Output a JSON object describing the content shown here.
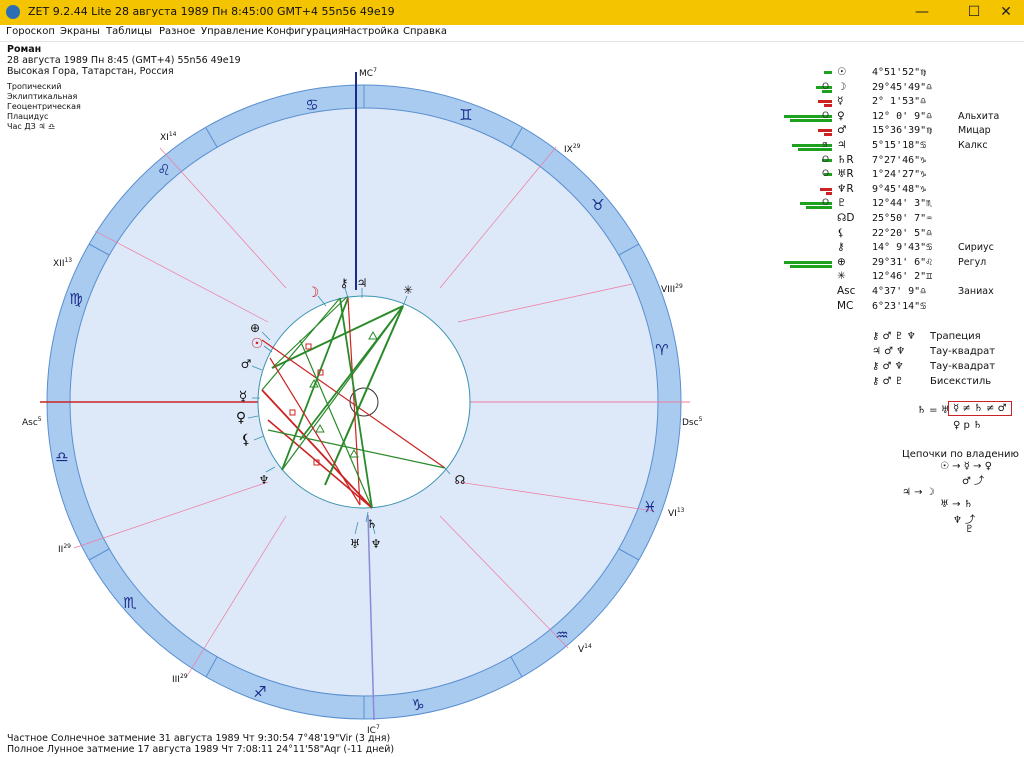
{
  "window": {
    "title": "ZET 9.2.44 Lite   28 августа 1989  Пн   8:45:00 GMT+4 55n56  49e19",
    "minimize": "—",
    "maximize": "☐",
    "close": "✕"
  },
  "menu": [
    "Гороскоп",
    "Экраны",
    "Таблицы",
    "Разное",
    "Управление",
    "Конфигурация",
    "Настройка",
    "Справка"
  ],
  "info": {
    "name": "Роман",
    "datetime": "28 августа 1989  Пн   8:45 (GMT+4) 55n56  49e19",
    "place": "Высокая Гора, Татарстан, Россия",
    "settings": [
      "Тропический",
      "Эклиптикальная",
      "Геоцентрическая",
      "Плацидус",
      "Час ДЗ  ♃  ♎"
    ]
  },
  "chart": {
    "axis_labels": {
      "mc": "MC",
      "mc_deg": "7",
      "ic": "IC",
      "ic_deg": "7",
      "asc": "Asc",
      "asc_deg": "5",
      "dsc": "Dsc",
      "dsc_deg": "5"
    },
    "house_labels": [
      {
        "num": "XI",
        "deg": "14"
      },
      {
        "num": "IX",
        "deg": "29"
      },
      {
        "num": "XII",
        "deg": "13"
      },
      {
        "num": "VIII",
        "deg": "29"
      },
      {
        "num": "VI",
        "deg": "13"
      },
      {
        "num": "II",
        "deg": "29"
      },
      {
        "num": "V",
        "deg": "14"
      },
      {
        "num": "III",
        "deg": "29"
      }
    ],
    "zodiac": [
      "♋",
      "♊",
      "♉",
      "♈",
      "♓",
      "♒",
      "♑",
      "♐",
      "♏",
      "♎",
      "♍",
      "♌"
    ],
    "planets": [
      "☽",
      "⚷",
      "♃",
      "✳",
      "⊕",
      "☉",
      "♂",
      "☿",
      "♀",
      "⚸",
      "♆",
      "♄",
      "♅",
      "♆",
      "☊"
    ]
  },
  "positions": [
    {
      "sym": "☉",
      "mark": "",
      "pos": "4°51'52\"♍",
      "star": "",
      "bar": 8,
      "red": false
    },
    {
      "sym": "☽",
      "mark": "O",
      "pos": "29°45'49\"♎",
      "star": "",
      "bar": 16,
      "red": false
    },
    {
      "sym": "☿",
      "mark": "",
      "pos": "2° 1'53\"♎",
      "star": "",
      "bar": 14,
      "red": true
    },
    {
      "sym": "♀",
      "mark": "O",
      "pos": "12° 0' 9\"♎",
      "star": "Альхита",
      "bar": 48,
      "red": false
    },
    {
      "sym": "♂",
      "mark": "",
      "pos": "15°36'39\"♍",
      "star": "Мицар",
      "bar": 14,
      "red": true
    },
    {
      "sym": "♃",
      "mark": "ϧ",
      "pos": "5°15'18\"♋",
      "star": "Калкс",
      "bar": 40,
      "red": false
    },
    {
      "sym": "♄R",
      "mark": "O",
      "pos": "7°27'46\"♑",
      "star": "",
      "bar": 10,
      "red": false
    },
    {
      "sym": "♅R",
      "mark": "O",
      "pos": "1°24'27\"♑",
      "star": "",
      "bar": 8,
      "red": false
    },
    {
      "sym": "♆R",
      "mark": "",
      "pos": "9°45'48\"♑",
      "star": "",
      "bar": 12,
      "red": true
    },
    {
      "sym": "♇",
      "mark": "O",
      "pos": "12°44' 3\"♏",
      "star": "",
      "bar": 32,
      "red": false
    },
    {
      "sym": "☊D",
      "mark": "",
      "pos": "25°50' 7\"♒",
      "star": "",
      "bar": 0,
      "red": false
    },
    {
      "sym": "⚸",
      "mark": "",
      "pos": "22°20' 5\"♎",
      "star": "",
      "bar": 0,
      "red": false
    },
    {
      "sym": "⚷",
      "mark": "",
      "pos": "14° 9'43\"♋",
      "star": "Сириус",
      "bar": 0,
      "red": false
    },
    {
      "sym": "⊕",
      "mark": "",
      "pos": "29°31' 6\"♌",
      "star": "Регул",
      "bar": 48,
      "red": false
    },
    {
      "sym": "✳",
      "mark": "",
      "pos": "12°46' 2\"♊",
      "star": "",
      "bar": 0,
      "red": false
    },
    {
      "sym": "Asc",
      "mark": "",
      "pos": "4°37' 9\"♎",
      "star": "Заниах",
      "bar": 0,
      "red": false
    },
    {
      "sym": "MC",
      "mark": "",
      "pos": "6°23'14\"♋",
      "star": "",
      "bar": 0,
      "red": false
    }
  ],
  "aspect_patterns": [
    {
      "glyphs": "⚷ ♂ ♇ ♆",
      "name": "Трапеция"
    },
    {
      "glyphs": "♃ ♂ ♆",
      "name": "Тау-квадрат"
    },
    {
      "glyphs": "⚷ ♂ ♆",
      "name": "Тау-квадрат"
    },
    {
      "glyphs": "⚷ ♂ ♇",
      "name": "Бисекстиль"
    }
  ],
  "formula": {
    "left": "♄ = ♅",
    "boxed": "☿ ≠ ♄ ≠ ♂",
    "below": "♀ p ♄"
  },
  "chains": {
    "title": "Цепочки по владению",
    "line1": "☉ → ☿ → ♀",
    "line2": "♂ ⤴",
    "line3": "♃ → ☽",
    "line4": "♅ → ♄",
    "line5": "♆ ⤴",
    "line6": "♇"
  },
  "eclipses": [
    "Частное Солнечное затмение 31 августа 1989 Чт  9:30:54  7°48'19\"Vir (3 дня)",
    "Полное Лунное затмение 17 августа 1989 Чт  7:08:11 24°11'58\"Aqr (-11 дней)"
  ]
}
